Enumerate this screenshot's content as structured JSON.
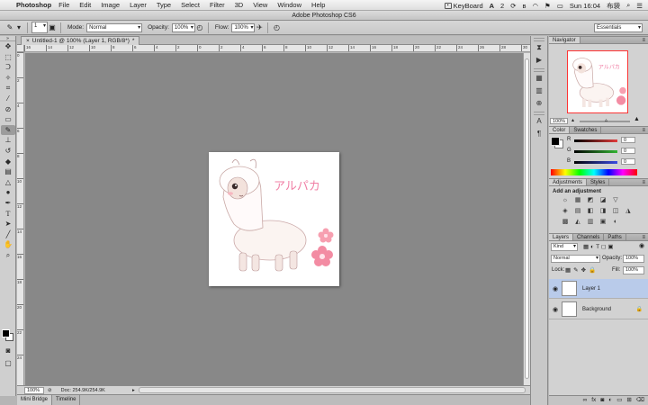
{
  "menubar": {
    "app_name": "Photoshop",
    "items": [
      "File",
      "Edit",
      "Image",
      "Layer",
      "Type",
      "Select",
      "Filter",
      "3D",
      "View",
      "Window",
      "Help"
    ],
    "keyboard_label": "KeyBoard",
    "clock": "Sun 16:04",
    "user": "布袋",
    "a_badge": "A",
    "a_count": "2"
  },
  "window": {
    "title": "Adobe Photoshop CS6"
  },
  "options": {
    "brush_size": "1",
    "mode_label": "Mode:",
    "mode_value": "Normal",
    "opacity_label": "Opacity:",
    "opacity_value": "100%",
    "flow_label": "Flow:",
    "flow_value": "100%",
    "workspace": "Essentials"
  },
  "document": {
    "tab_title": "Untitled-1 @ 100% (Layer 1, RGB/8*)",
    "tab_modified": "*",
    "artwork_text": "アルパカ",
    "ruler_marks": [
      "16",
      "14",
      "12",
      "10",
      "8",
      "6",
      "4",
      "2",
      "0",
      "2",
      "4",
      "6",
      "8",
      "10",
      "12",
      "14",
      "16",
      "18",
      "20",
      "22",
      "24",
      "26",
      "28",
      "30"
    ],
    "ruler_v_marks": [
      "0",
      "2",
      "4",
      "6",
      "8",
      "10",
      "12",
      "14",
      "16",
      "18",
      "20",
      "22",
      "24"
    ]
  },
  "status": {
    "zoom": "100%",
    "doc": "Doc: 254.9K/254.9K"
  },
  "bottom_tabs": [
    "Mini Bridge",
    "Timeline"
  ],
  "navigator": {
    "title": "Navigator",
    "zoom": "100%",
    "thumb_text": "アルパカ"
  },
  "color": {
    "tabs": [
      "Color",
      "Swatches"
    ],
    "channels": [
      {
        "label": "R",
        "value": "0",
        "color": "#e23b3b"
      },
      {
        "label": "G",
        "value": "0",
        "color": "#34b534"
      },
      {
        "label": "B",
        "value": "0",
        "color": "#3b4be2"
      }
    ]
  },
  "adjustments": {
    "tabs": [
      "Adjustments",
      "Styles"
    ],
    "add_label": "Add an adjustment",
    "icons": [
      "☼",
      "▦",
      "◩",
      "◪",
      "▽",
      "◈",
      "▤",
      "◧",
      "◨",
      "◫",
      "◮",
      "▩",
      "◭",
      "▥",
      "▣",
      "◐",
      "⧉",
      "▧"
    ]
  },
  "layers": {
    "tabs": [
      "Layers",
      "Channels",
      "Paths"
    ],
    "kind": "Kind",
    "blend": "Normal",
    "opacity_label": "Opacity:",
    "opacity_value": "100%",
    "lock_label": "Lock:",
    "fill_label": "Fill:",
    "fill_value": "100%",
    "rows": [
      {
        "name": "Layer 1",
        "selected": true
      },
      {
        "name": "Background",
        "selected": false
      }
    ]
  }
}
